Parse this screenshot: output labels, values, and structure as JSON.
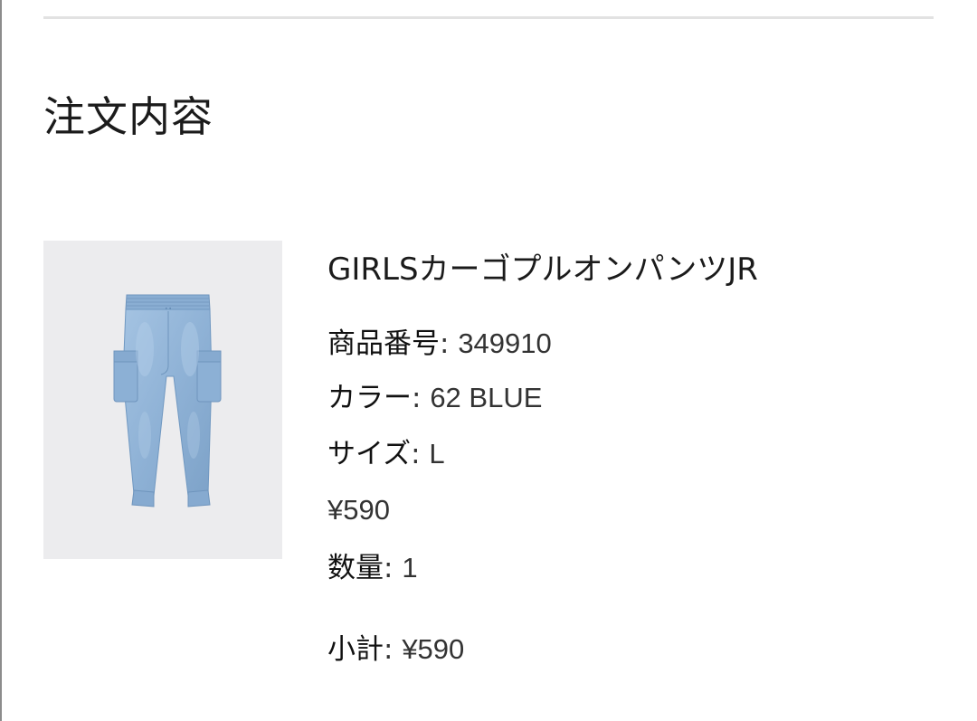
{
  "order": {
    "section_title": "注文内容",
    "item": {
      "name": "GIRLSカーゴプルオンパンツJR",
      "product_number_label": "商品番号",
      "product_number": "349910",
      "color_label": "カラー",
      "color_value": "62 BLUE",
      "size_label": "サイズ",
      "size_value": "L",
      "price": "¥590",
      "quantity_label": "数量",
      "quantity": "1",
      "subtotal_label": "小計",
      "subtotal": "¥590",
      "image_icon": "jeans-product-image"
    }
  },
  "colors": {
    "denim": "#8fb2d6",
    "thumbnail_bg": "#ececee",
    "divider": "#e2e2e2"
  }
}
